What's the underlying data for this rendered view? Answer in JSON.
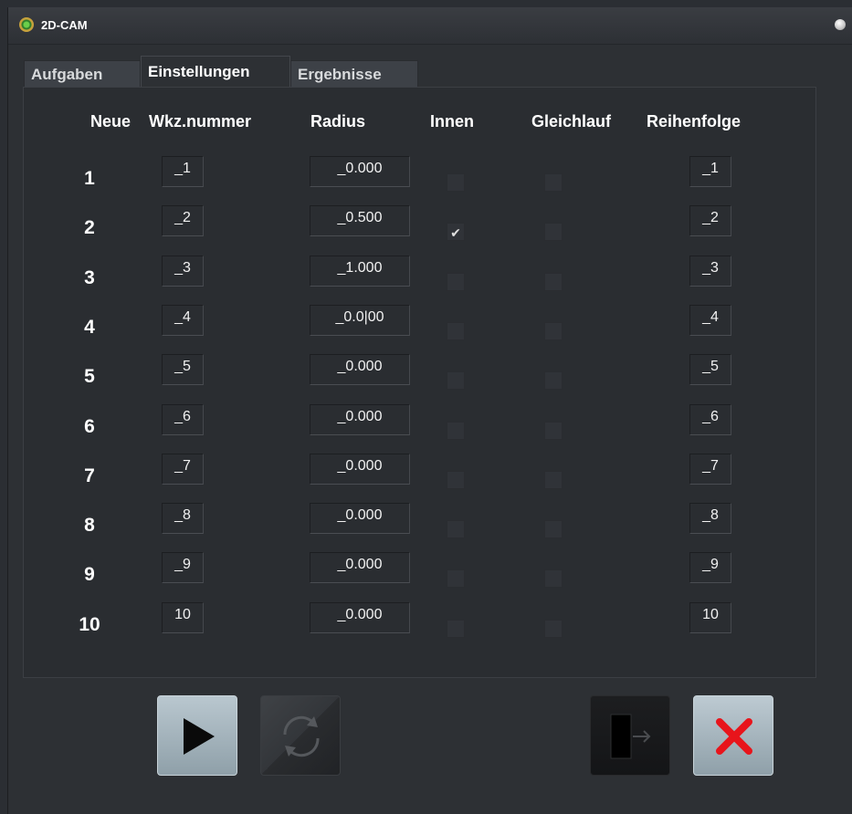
{
  "window": {
    "title": "2D-CAM"
  },
  "tabs": [
    "Aufgaben",
    "Einstellungen",
    "Ergebnisse"
  ],
  "active_tab": "Einstellungen",
  "columns": {
    "neue": "Neue",
    "wkz": "Wkz.nummer",
    "radius": "Radius",
    "innen": "Innen",
    "gleichlauf": "Gleichlauf",
    "reihenfolge": "Reihenfolge"
  },
  "rows": [
    {
      "num": "1",
      "wkz": "_1",
      "radius": "_0.000",
      "innen": false,
      "gleichlauf": false,
      "reihenfolge": "_1"
    },
    {
      "num": "2",
      "wkz": "_2",
      "radius": "_0.500",
      "innen": true,
      "gleichlauf": false,
      "reihenfolge": "_2"
    },
    {
      "num": "3",
      "wkz": "_3",
      "radius": "_1.000",
      "innen": false,
      "gleichlauf": false,
      "reihenfolge": "_3"
    },
    {
      "num": "4",
      "wkz": "_4",
      "radius": "_0.0|00",
      "innen": false,
      "gleichlauf": false,
      "reihenfolge": "_4"
    },
    {
      "num": "5",
      "wkz": "_5",
      "radius": "_0.000",
      "innen": false,
      "gleichlauf": false,
      "reihenfolge": "_5"
    },
    {
      "num": "6",
      "wkz": "_6",
      "radius": "_0.000",
      "innen": false,
      "gleichlauf": false,
      "reihenfolge": "_6"
    },
    {
      "num": "7",
      "wkz": "_7",
      "radius": "_0.000",
      "innen": false,
      "gleichlauf": false,
      "reihenfolge": "_7"
    },
    {
      "num": "8",
      "wkz": "_8",
      "radius": "_0.000",
      "innen": false,
      "gleichlauf": false,
      "reihenfolge": "_8"
    },
    {
      "num": "9",
      "wkz": "_9",
      "radius": "_0.000",
      "innen": false,
      "gleichlauf": false,
      "reihenfolge": "_9"
    },
    {
      "num": "10",
      "wkz": "10",
      "radius": "_0.000",
      "innen": false,
      "gleichlauf": false,
      "reihenfolge": "10"
    }
  ],
  "buttons": [
    {
      "icon": "play-icon",
      "enabled": true
    },
    {
      "icon": "sync-icon",
      "enabled": false
    },
    {
      "icon": "exit-icon",
      "enabled": true
    },
    {
      "icon": "cancel-icon",
      "enabled": true
    }
  ],
  "colors": {
    "background": "#2b2e33",
    "panel": "#2a2d31",
    "text": "#ffffff",
    "button_light": "#a9b8c0",
    "cancel_x": "#e8141b"
  }
}
